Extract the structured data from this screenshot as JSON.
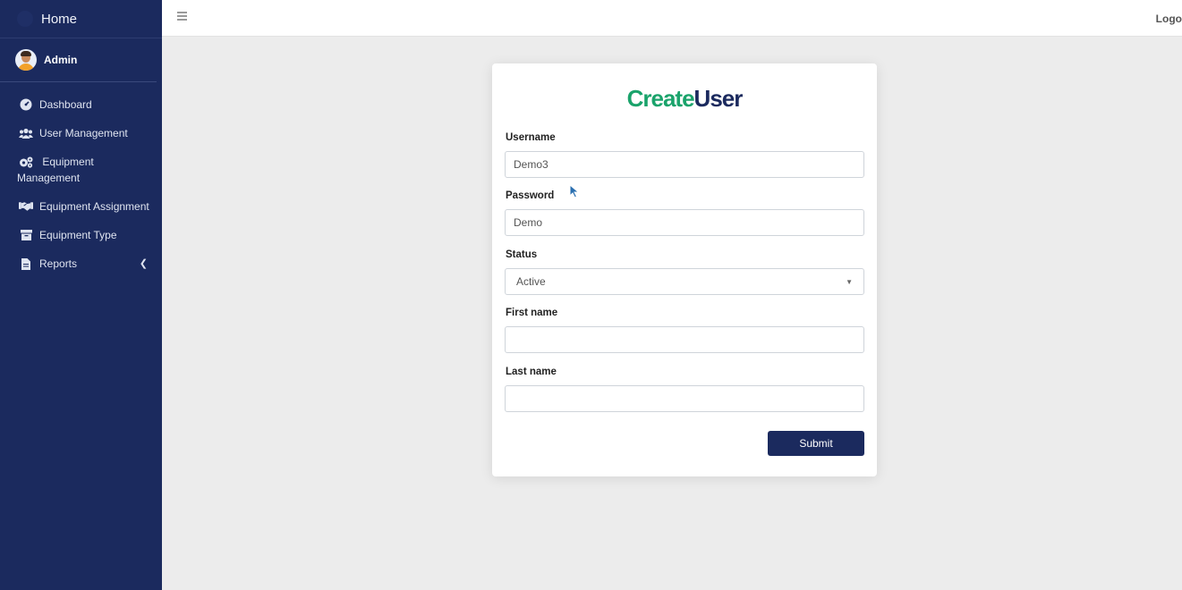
{
  "brand": {
    "title": "Home"
  },
  "user": {
    "name": "Admin"
  },
  "sidebar": {
    "items": [
      {
        "label": "Dashboard",
        "icon": "dashboard-icon"
      },
      {
        "label": "User Management",
        "icon": "users-icon"
      },
      {
        "label": "Equipment Management",
        "icon": "cogs-icon"
      },
      {
        "label": "Equipment Assignment",
        "icon": "handshake-icon"
      },
      {
        "label": "Equipment Type",
        "icon": "archive-icon"
      },
      {
        "label": "Reports",
        "icon": "file-icon"
      }
    ]
  },
  "topbar": {
    "logout_label": "Logo"
  },
  "form": {
    "title_part1": "Create",
    "title_part2": "User",
    "username_label": "Username",
    "username_value": "Demo3",
    "password_label": "Password",
    "password_value": "Demo",
    "status_label": "Status",
    "status_value": "Active",
    "firstname_label": "First name",
    "firstname_value": "",
    "lastname_label": "Last name",
    "lastname_value": "",
    "submit_label": "Submit"
  },
  "colors": {
    "sidebar_bg": "#1b2a5e",
    "title_green": "#1aa36b",
    "title_navy": "#1b2a5e",
    "button_bg": "#1b2a5e",
    "page_bg": "#ececec"
  }
}
